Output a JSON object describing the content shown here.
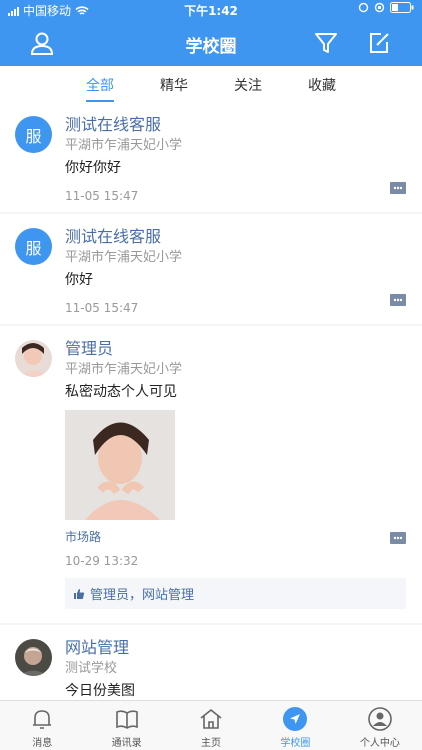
{
  "status": {
    "carrier": "中国移动",
    "time": "下午1:42"
  },
  "header": {
    "title": "学校圈"
  },
  "tabs": [
    "全部",
    "精华",
    "关注",
    "收藏"
  ],
  "posts": [
    {
      "avatar_text": "服",
      "name": "测试在线客服",
      "school": "平湖市乍浦天妃小学",
      "content": "你好你好",
      "time": "11-05 15:47"
    },
    {
      "avatar_text": "服",
      "name": "测试在线客服",
      "school": "平湖市乍浦天妃小学",
      "content": "你好",
      "time": "11-05 15:47"
    },
    {
      "name": "管理员",
      "school": "平湖市乍浦天妃小学",
      "content": "私密动态个人可见",
      "location": "市场路",
      "time": "10-29 13:32",
      "likes": "管理员，网站管理"
    },
    {
      "name": "网站管理",
      "school": "测试学校",
      "content": "今日份美图"
    }
  ],
  "tabbar": [
    "消息",
    "通讯录",
    "主页",
    "学校圈",
    "个人中心"
  ],
  "colors": {
    "primary": "#3f96f0",
    "link": "#4a6fa5"
  }
}
